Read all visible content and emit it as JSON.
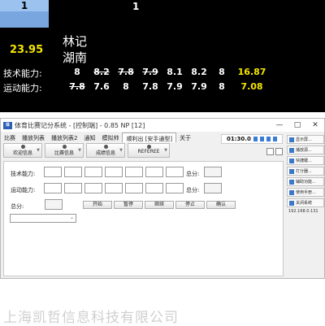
{
  "board": {
    "num_left": "1",
    "num_center": "1",
    "total_score": "23.95",
    "name_line1": "林记",
    "name_line2": "湖南",
    "rows": [
      {
        "label": "技术能力:",
        "cells": [
          {
            "v": "8",
            "strike": false
          },
          {
            "v": "8.2",
            "strike": true
          },
          {
            "v": "7.8",
            "strike": true
          },
          {
            "v": "7.9",
            "strike": true
          },
          {
            "v": "8.1",
            "strike": false
          },
          {
            "v": "8.2",
            "strike": false
          },
          {
            "v": "8",
            "strike": false
          }
        ],
        "total": "16.87"
      },
      {
        "label": "运动能力:",
        "cells": [
          {
            "v": "7.8",
            "strike": true
          },
          {
            "v": "7.6",
            "strike": false
          },
          {
            "v": "8",
            "strike": false
          },
          {
            "v": "7.8",
            "strike": false
          },
          {
            "v": "7.9",
            "strike": false
          },
          {
            "v": "7.9",
            "strike": false
          },
          {
            "v": "8",
            "strike": false
          }
        ],
        "total": "7.08"
      }
    ],
    "colors": {
      "total": "#f5e600",
      "header_blue": "#7aa6e0"
    }
  },
  "window": {
    "title": "体育比赛记分系统 - [控制端] - 0.85 NP [12]",
    "controls": [
      "—",
      "□",
      "✕"
    ],
    "menu": [
      "比赛",
      "播放列表",
      "播放列表2",
      "通知",
      "模拟帅",
      "顺利出 [安手通型]",
      "关于"
    ],
    "active_menu_index": 5,
    "timer": "01:30.0",
    "toolbar": [
      "欢迎信息",
      "比赛信息",
      "成绩信息",
      "REFEREE"
    ],
    "form": {
      "tech_label": "技术能力:",
      "motion_label": "运动能力:",
      "total_label": "总分:",
      "sum_label": "总分:",
      "buttons": [
        "开始",
        "暂停",
        "继续",
        "停止",
        "确认"
      ]
    },
    "sidebar": [
      "显示屏...",
      "播放源...",
      "快捷键...",
      "打分器...",
      "辅助功能...",
      "使用手册...",
      "关闭系统"
    ],
    "ip": "192.168.0.131"
  },
  "watermark": "上海凯哲信息科技有限公司"
}
